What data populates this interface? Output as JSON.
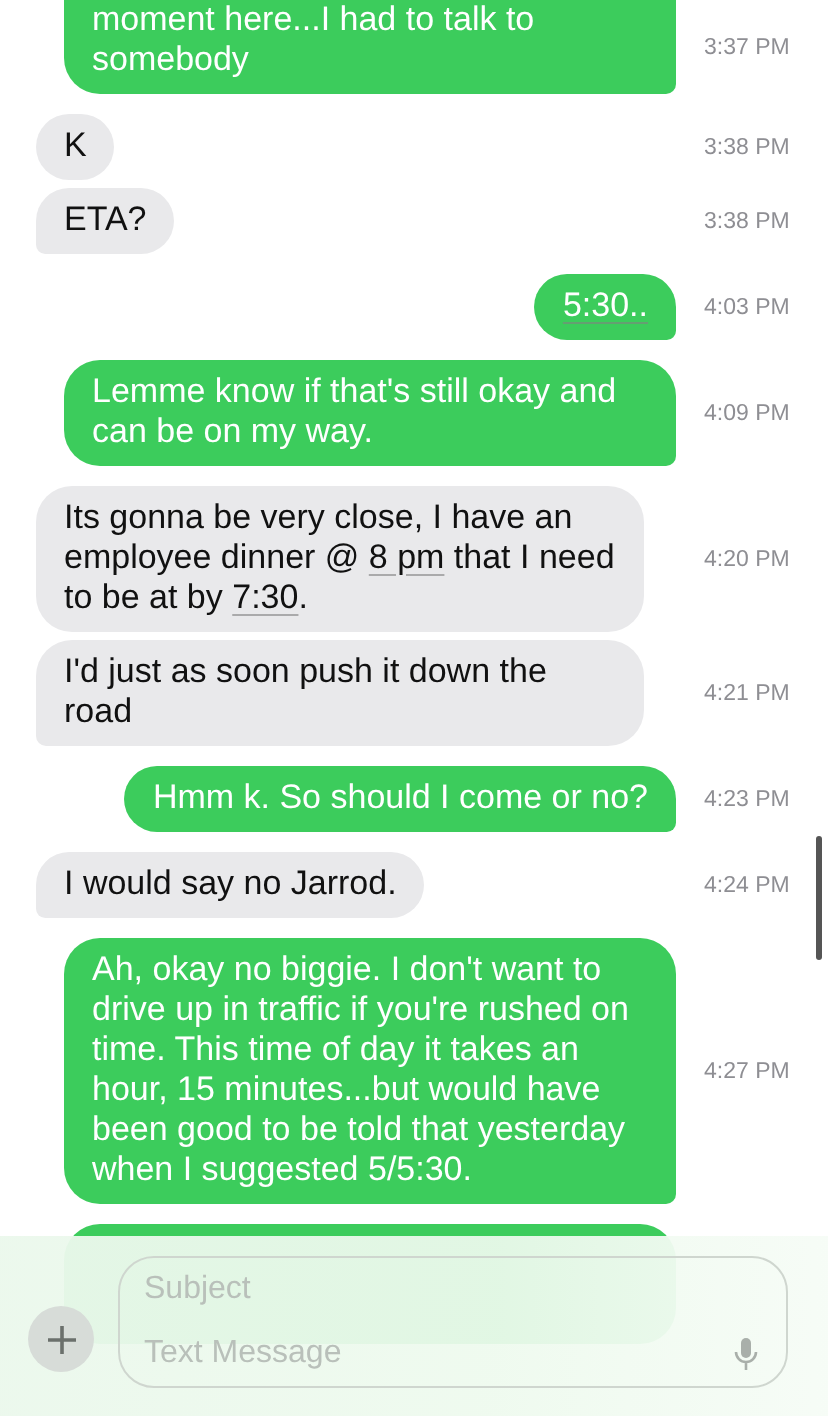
{
  "messages": [
    {
      "kind": "sent",
      "tail": true,
      "cut_top": true,
      "parts": [
        {
          "text": "moment here...I had to talk to somebody"
        }
      ],
      "time": "3:37 PM"
    },
    {
      "kind": "received",
      "tail": false,
      "parts": [
        {
          "text": "K"
        }
      ],
      "time": "3:38 PM"
    },
    {
      "kind": "received",
      "tail": true,
      "parts": [
        {
          "text": "ETA?"
        }
      ],
      "time": "3:38 PM"
    },
    {
      "kind": "sent",
      "tail": true,
      "parts": [
        {
          "text": "5:30..",
          "link": true
        }
      ],
      "time": "4:03 PM"
    },
    {
      "kind": "sent",
      "tail": true,
      "parts": [
        {
          "text": "Lemme know if that's still okay and can be on my way."
        }
      ],
      "time": "4:09 PM"
    },
    {
      "kind": "received",
      "tail": false,
      "parts": [
        {
          "text": "Its gonna be very close, I have an employee dinner @ "
        },
        {
          "text": "8 pm",
          "link": true
        },
        {
          "text": " that I need to be at by "
        },
        {
          "text": "7:30",
          "link": true
        },
        {
          "text": "."
        }
      ],
      "time": "4:20 PM"
    },
    {
      "kind": "received",
      "tail": true,
      "parts": [
        {
          "text": "I'd just as soon push it down the road"
        }
      ],
      "time": "4:21 PM"
    },
    {
      "kind": "sent",
      "tail": true,
      "parts": [
        {
          "text": "Hmm k. So should I come or no?"
        }
      ],
      "time": "4:23 PM"
    },
    {
      "kind": "received",
      "tail": true,
      "parts": [
        {
          "text": "I would say no Jarrod."
        }
      ],
      "time": "4:24 PM"
    },
    {
      "kind": "sent",
      "tail": true,
      "parts": [
        {
          "text": "Ah, okay no biggie. I don't want to drive up in traffic if you're rushed on time. This time of day it takes an hour, 15 minutes...but would have been good to be told that yesterday when I suggested 5/5:30."
        }
      ],
      "time": "4:27 PM"
    }
  ],
  "composer": {
    "subject": {
      "placeholder": "Subject"
    },
    "message": {
      "placeholder": "Text Message"
    }
  }
}
